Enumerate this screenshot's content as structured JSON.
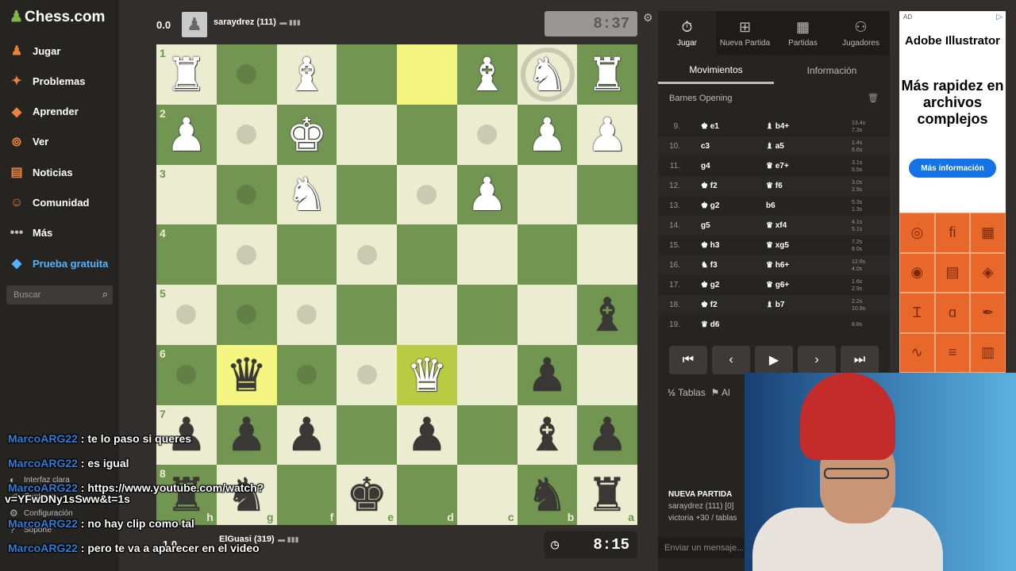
{
  "sidebar": {
    "logo": "Chess.com",
    "items": [
      {
        "label": "Jugar",
        "icon": "play-icon"
      },
      {
        "label": "Problemas",
        "icon": "puzzle-icon"
      },
      {
        "label": "Aprender",
        "icon": "learn-icon"
      },
      {
        "label": "Ver",
        "icon": "binoculars-icon"
      },
      {
        "label": "Noticias",
        "icon": "news-icon"
      },
      {
        "label": "Comunidad",
        "icon": "community-icon"
      },
      {
        "label": "Más",
        "icon": "more-icon"
      },
      {
        "label": "Prueba gratuita",
        "icon": "diamond-icon"
      }
    ],
    "search_placeholder": "Buscar",
    "bottom_links": [
      "Interfaz clara",
      "Contraer",
      "Configuración",
      "Soporte"
    ]
  },
  "top_player": {
    "score": "0.0",
    "name": "saraydrez (111)",
    "clock": "8:37"
  },
  "bottom_player": {
    "score": "1.0",
    "name": "ElGuasi (319)",
    "clock": "8:15"
  },
  "board": {
    "ranks": [
      "1",
      "2",
      "3",
      "4",
      "5",
      "6",
      "7",
      "8"
    ],
    "files": [
      "h",
      "g",
      "f",
      "e",
      "d",
      "c",
      "b",
      "a"
    ],
    "rows": [
      [
        {
          "p": "♜",
          "c": "w"
        },
        {
          "dot": 1
        },
        {
          "p": "♝",
          "c": "w"
        },
        {},
        {
          "hl": 1
        },
        {
          "p": "♝",
          "c": "w"
        },
        {
          "p": "♞",
          "c": "w",
          "ring": 1
        },
        {
          "p": "♜",
          "c": "w"
        }
      ],
      [
        {
          "p": "♟",
          "c": "w"
        },
        {
          "dot": 1
        },
        {
          "p": "♚",
          "c": "w"
        },
        {},
        {},
        {
          "dot": 1
        },
        {
          "p": "♟",
          "c": "w"
        },
        {
          "p": "♟",
          "c": "w"
        }
      ],
      [
        {},
        {
          "dot": 1
        },
        {
          "p": "♞",
          "c": "w"
        },
        {},
        {
          "dot": 1
        },
        {
          "p": "♟",
          "c": "w"
        },
        {},
        {}
      ],
      [
        {},
        {
          "dot": 1
        },
        {},
        {
          "dot": 1
        },
        {},
        {},
        {},
        {}
      ],
      [
        {
          "dot": 1
        },
        {
          "dot": 1
        },
        {
          "dot": 1
        },
        {},
        {},
        {},
        {},
        {
          "p": "♝",
          "c": "b"
        }
      ],
      [
        {
          "dot": 1
        },
        {
          "p": "♛",
          "c": "b",
          "hl": 1
        },
        {
          "dot": 1
        },
        {
          "dot": 1
        },
        {
          "p": "♛",
          "c": "w",
          "hl": 1
        },
        {},
        {
          "p": "♟",
          "c": "b"
        },
        {}
      ],
      [
        {
          "p": "♟",
          "c": "b"
        },
        {
          "p": "♟",
          "c": "b"
        },
        {
          "p": "♟",
          "c": "b"
        },
        {},
        {
          "p": "♟",
          "c": "b"
        },
        {},
        {
          "p": "♝",
          "c": "b"
        },
        {
          "p": "♟",
          "c": "b"
        }
      ],
      [
        {
          "p": "♜",
          "c": "b"
        },
        {
          "p": "♞",
          "c": "b"
        },
        {},
        {
          "p": "♚",
          "c": "b"
        },
        {},
        {},
        {
          "p": "♞",
          "c": "b"
        },
        {
          "p": "♜",
          "c": "b"
        }
      ]
    ]
  },
  "panel": {
    "tabs": [
      "Jugar",
      "Nueva Partida",
      "Partidas",
      "Jugadores"
    ],
    "subtabs": [
      "Movimientos",
      "Información"
    ],
    "opening": "Barnes Opening",
    "moves": [
      {
        "n": "9.",
        "w": "♚ e1",
        "b": "♝ b4+",
        "t1": "13.4s",
        "t2": "7.3s"
      },
      {
        "n": "10.",
        "w": "c3",
        "b": "♝ a5",
        "t1": "1.4s",
        "t2": "6.6s"
      },
      {
        "n": "11.",
        "w": "g4",
        "b": "♛ e7+",
        "t1": "3.1s",
        "t2": "5.5s"
      },
      {
        "n": "12.",
        "w": "♚ f2",
        "b": "♛ f6",
        "t1": "3.0s",
        "t2": "2.9s"
      },
      {
        "n": "13.",
        "w": "♚ g2",
        "b": "b6",
        "t1": "5.3s",
        "t2": "1.3s"
      },
      {
        "n": "14.",
        "w": "g5",
        "b": "♛ xf4",
        "t1": "4.1s",
        "t2": "5.1s"
      },
      {
        "n": "15.",
        "w": "♚ h3",
        "b": "♛ xg5",
        "t1": "7.2s",
        "t2": "8.0s"
      },
      {
        "n": "16.",
        "w": "♞ f3",
        "b": "♛ h6+",
        "t1": "12.8s",
        "t2": "4.0s"
      },
      {
        "n": "17.",
        "w": "♚ g2",
        "b": "♛ g6+",
        "t1": "1.6s",
        "t2": "2.9s"
      },
      {
        "n": "18.",
        "w": "♚ f2",
        "b": "♝ b7",
        "t1": "2.2s",
        "t2": "10.8s"
      },
      {
        "n": "19.",
        "w": "♛ d6",
        "b": "",
        "t1": "8.8s",
        "t2": ""
      }
    ],
    "draw_label": "Tablas",
    "abort_label": "Al",
    "new_game_title": "NUEVA PARTIDA",
    "new_game_line1": "saraydrez (111) [0] ",
    "new_game_line2": "victoria +30 / tablas",
    "message_placeholder": "Enviar un mensaje..."
  },
  "ad": {
    "tag": "AD",
    "brand": "Adobe Illustrator",
    "text": "Más rapidez en archivos complejos",
    "button": "Más información"
  },
  "chat": [
    {
      "user": "MarcoARG22",
      "msg": " : te lo paso si queres"
    },
    {
      "user": "MarcoARG22",
      "msg": " : es igual"
    },
    {
      "user": "MarcoARG22",
      "msg": " : https://www.youtube.com/watch?"
    },
    {
      "user": "",
      "msg": "v=YFwDNy1sSww&t=1s"
    },
    {
      "user": "MarcoARG22",
      "msg": " : no hay clip como tal"
    },
    {
      "user": "MarcoARG22",
      "msg": " : pero te va a aparecer en el video"
    }
  ]
}
